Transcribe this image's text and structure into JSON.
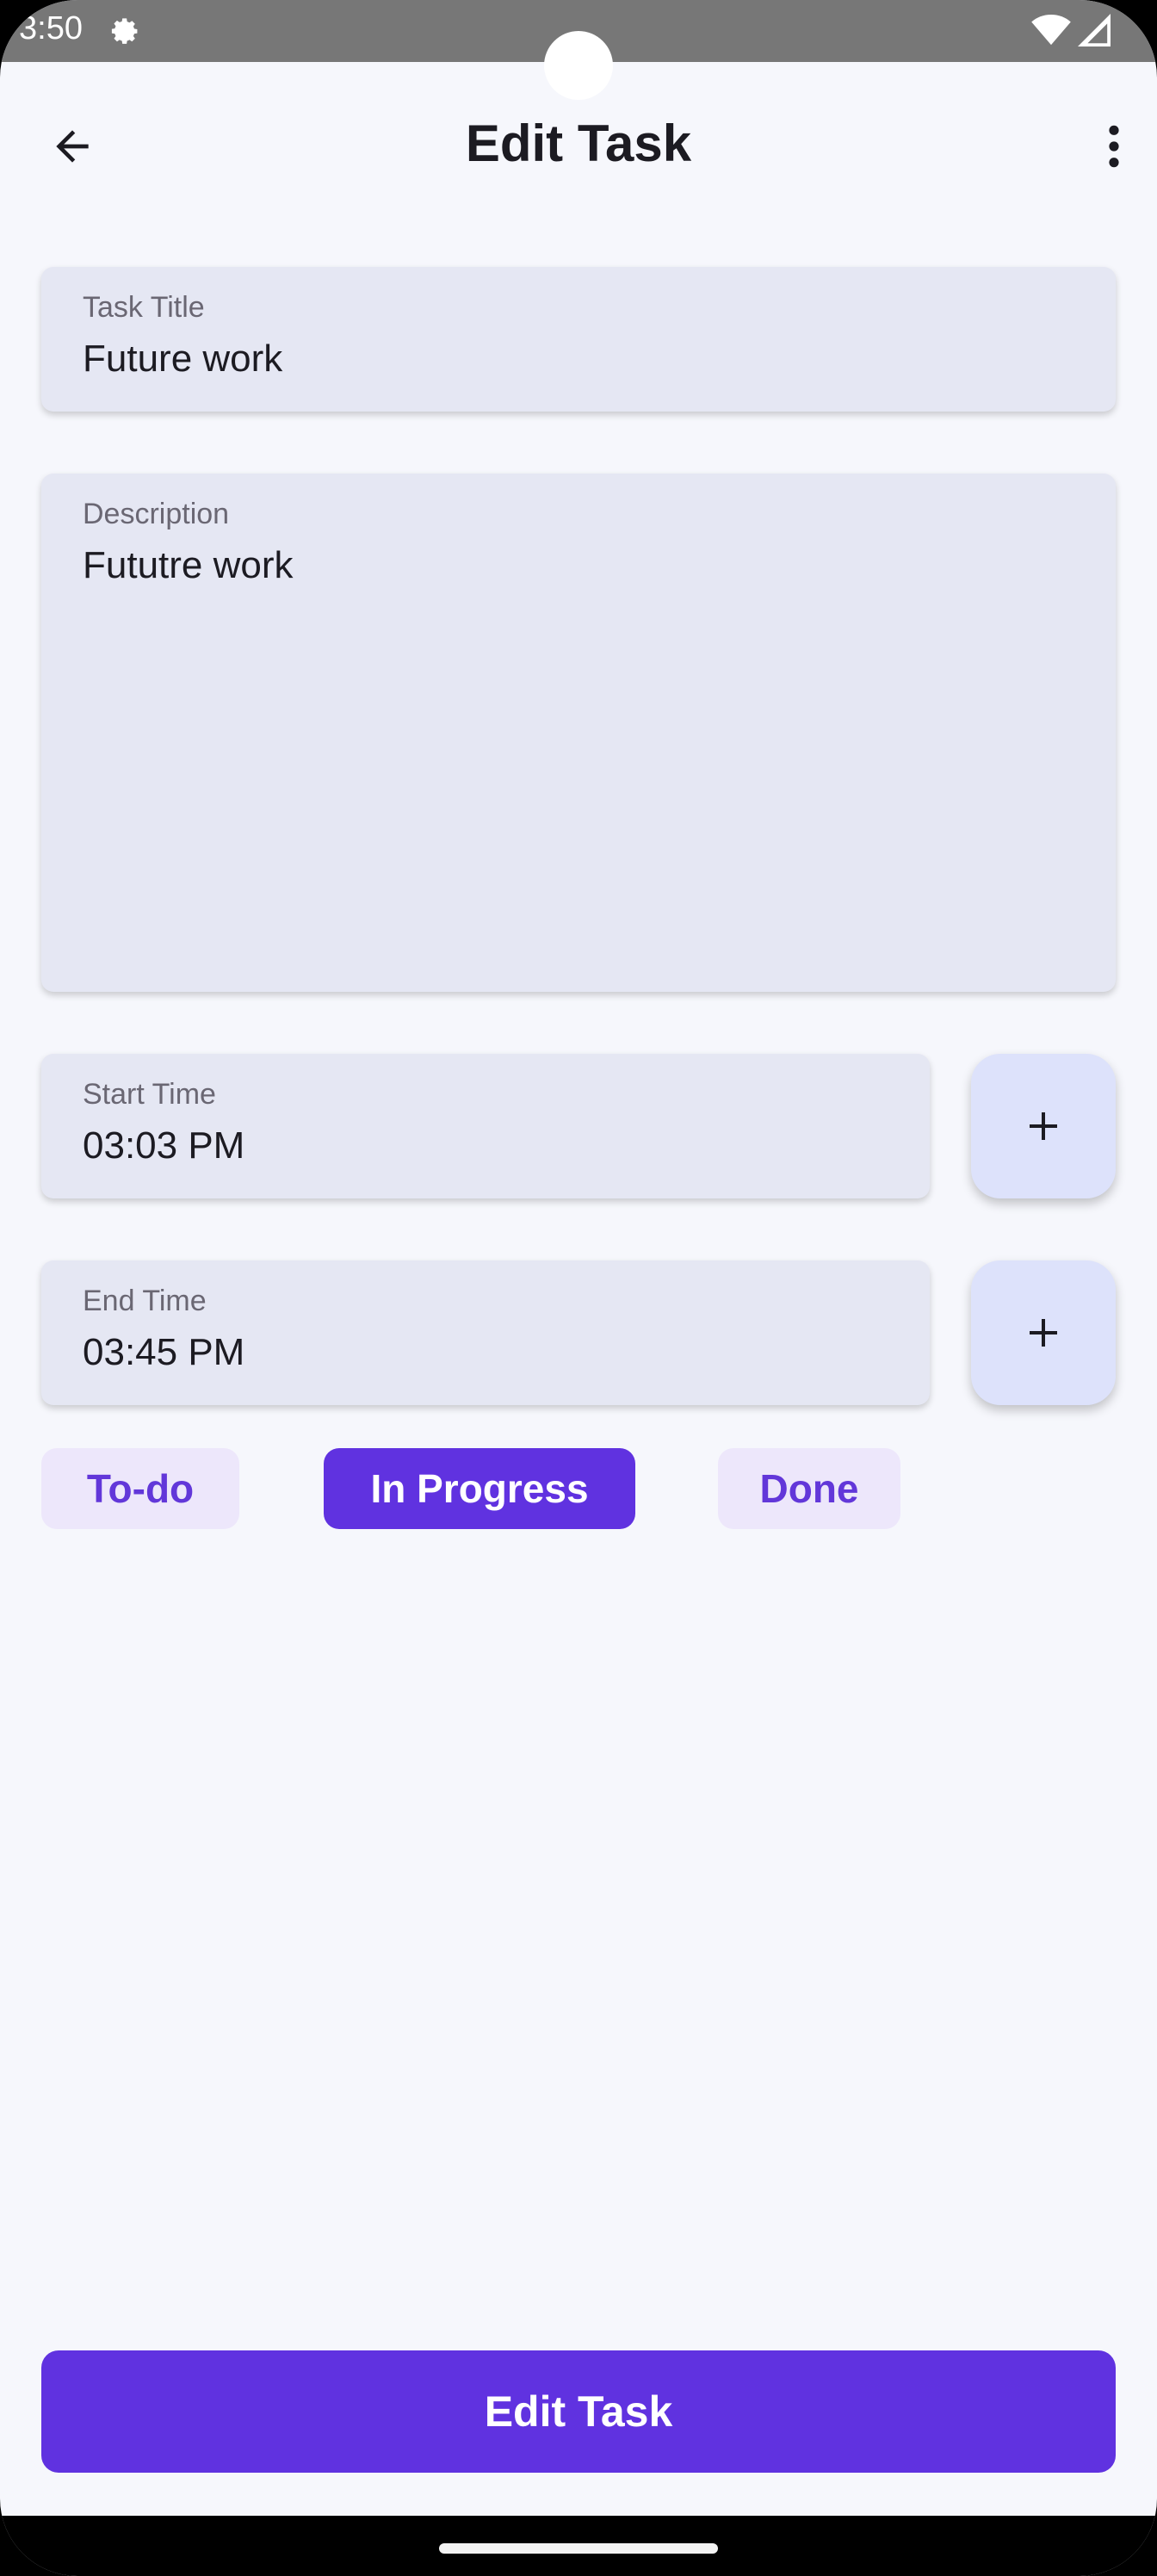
{
  "status_bar": {
    "time": "3:50",
    "icons": [
      "gear-icon",
      "wifi-icon",
      "signal-icon"
    ]
  },
  "app_bar": {
    "title": "Edit Task",
    "back_icon": "arrow-back-icon",
    "menu_icon": "more-vertical-icon"
  },
  "form": {
    "title_label": "Task Title",
    "title_value": "Future work",
    "description_label": "Description",
    "description_value": "Fututre work",
    "start_label": "Start Time",
    "start_value": "03:03 PM",
    "end_label": "End Time",
    "end_value": "03:45 PM"
  },
  "status_options": {
    "items": [
      "To-do",
      "In Progress",
      "Done"
    ],
    "selected": "In Progress"
  },
  "submit": {
    "label": "Edit Task"
  },
  "colors": {
    "accent": "#6032e0",
    "chip_bg": "#ede7fb",
    "field_bg": "#e5e7f3",
    "page_bg": "#f6f7fc"
  }
}
